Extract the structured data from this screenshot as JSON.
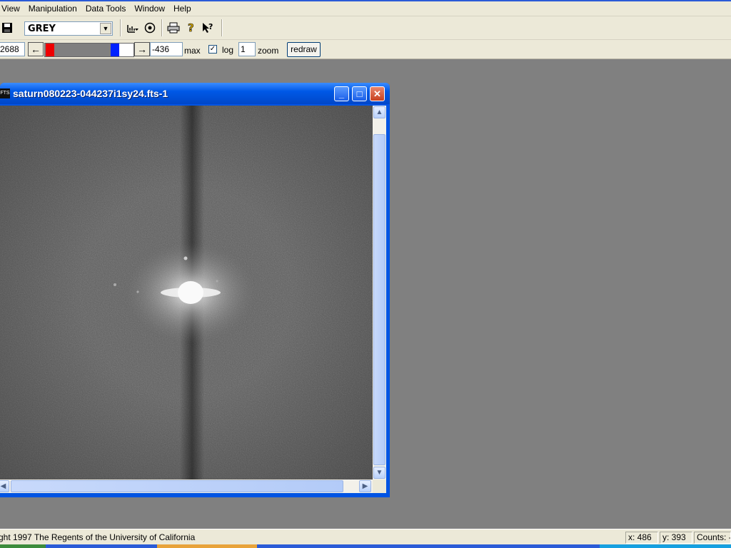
{
  "menubar": {
    "items": [
      "View",
      "Manipulation",
      "Data Tools",
      "Window",
      "Help"
    ]
  },
  "toolbar": {
    "colormap_value": "GREY",
    "icons": [
      "save-icon",
      "line-profile-icon",
      "target-icon",
      "print-icon",
      "help-icon",
      "context-help-icon"
    ]
  },
  "scale_bar": {
    "min_value": "2688",
    "max_value": "-436",
    "max_label": "max",
    "log_label": "log",
    "log_checked": true,
    "zoom_value": "1",
    "zoom_label": "zoom",
    "redraw_label": "redraw"
  },
  "image_window": {
    "title": "saturn080223-044237i1sy24.fts-1",
    "icon_text": "FTS",
    "minimize_label": "_",
    "maximize_label": "□",
    "close_label": "✕"
  },
  "statusbar": {
    "copyright": "ght 1997 The Regents of the University of California",
    "x_readout": "x: 486",
    "y_readout": "y: 393",
    "counts_readout": "Counts: -"
  }
}
